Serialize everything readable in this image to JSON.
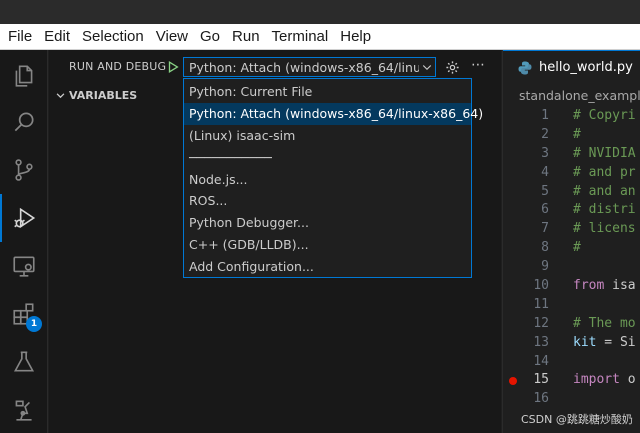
{
  "menubar": {
    "items": [
      "File",
      "Edit",
      "Selection",
      "View",
      "Go",
      "Run",
      "Terminal",
      "Help"
    ]
  },
  "activitybar": {
    "icons": [
      "files-icon",
      "search-icon",
      "source-control-icon",
      "run-debug-icon",
      "remote-explorer-icon",
      "extensions-icon",
      "testing-icon",
      "robot-icon"
    ],
    "extensions_badge": "1",
    "accent_color": "#0078d4"
  },
  "sidebar": {
    "header": "RUN AND DEBUG",
    "selected_config": "Python: Attach (windows-x86_64/linu",
    "variables_label": "VARIABLES"
  },
  "dropdown": {
    "options": [
      "Python: Current File",
      "Python: Attach (windows-x86_64/linux-x86_64)",
      "(Linux) isaac-sim",
      "───────────",
      "Node.js...",
      "ROS...",
      "Python Debugger...",
      "C++ (GDB/LLDB)...",
      "Add Configuration..."
    ],
    "selected_index": 1
  },
  "editor": {
    "tab_name": "hello_world.py",
    "breadcrumb": "standalone_example",
    "lines": [
      {
        "n": "1",
        "text": "# Copyri",
        "kind": "comment"
      },
      {
        "n": "2",
        "text": "#",
        "kind": "comment"
      },
      {
        "n": "3",
        "text": "# NVIDIA",
        "kind": "comment"
      },
      {
        "n": "4",
        "text": "# and pr",
        "kind": "comment"
      },
      {
        "n": "5",
        "text": "# and an",
        "kind": "comment"
      },
      {
        "n": "6",
        "text": "# distri",
        "kind": "comment"
      },
      {
        "n": "7",
        "text": "# licens",
        "kind": "comment"
      },
      {
        "n": "8",
        "text": "#",
        "kind": "comment"
      },
      {
        "n": "9",
        "text": "",
        "kind": "plain"
      },
      {
        "n": "10",
        "text_kw": "from",
        "text_rest": " isa",
        "kind": "kw"
      },
      {
        "n": "11",
        "text": "",
        "kind": "plain"
      },
      {
        "n": "12",
        "text": "# The mo",
        "kind": "comment"
      },
      {
        "n": "13",
        "text_var": "kit",
        "text_rest": " = Si",
        "kind": "var"
      },
      {
        "n": "14",
        "text": "",
        "kind": "plain"
      },
      {
        "n": "15",
        "text_kw": "import",
        "text_rest": " o",
        "kind": "kw",
        "breakpoint": true
      },
      {
        "n": "16",
        "text": "",
        "kind": "plain"
      }
    ]
  },
  "watermark": "CSDN @跳跳糖炒酸奶"
}
